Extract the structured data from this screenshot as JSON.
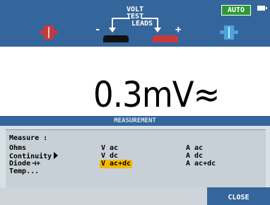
{
  "header": {
    "line1": "VOLT",
    "line2": "TEST",
    "line3": "LEADS",
    "minus": "-",
    "plus": "+",
    "auto_badge": "AUTO"
  },
  "reading": {
    "value": "0.3mV≈"
  },
  "menu": {
    "title": "MEASUREMENT",
    "heading": "Measure :",
    "col1": [
      "Ohms",
      "Continuity",
      "Diode",
      "Temp..."
    ],
    "col2": [
      "V ac",
      "V dc",
      "V ac+dc"
    ],
    "col3": [
      "A ac",
      "A dc",
      "A ac+dc"
    ],
    "selected": "V ac+dc"
  },
  "softkeys": {
    "close": "CLOSE"
  },
  "colors": {
    "header_blue": "#35669b",
    "auto_green": "#2c9b34",
    "highlight": "#f4b800",
    "red_probe": "#c9383c",
    "blue_probe": "#4aa3e0"
  }
}
